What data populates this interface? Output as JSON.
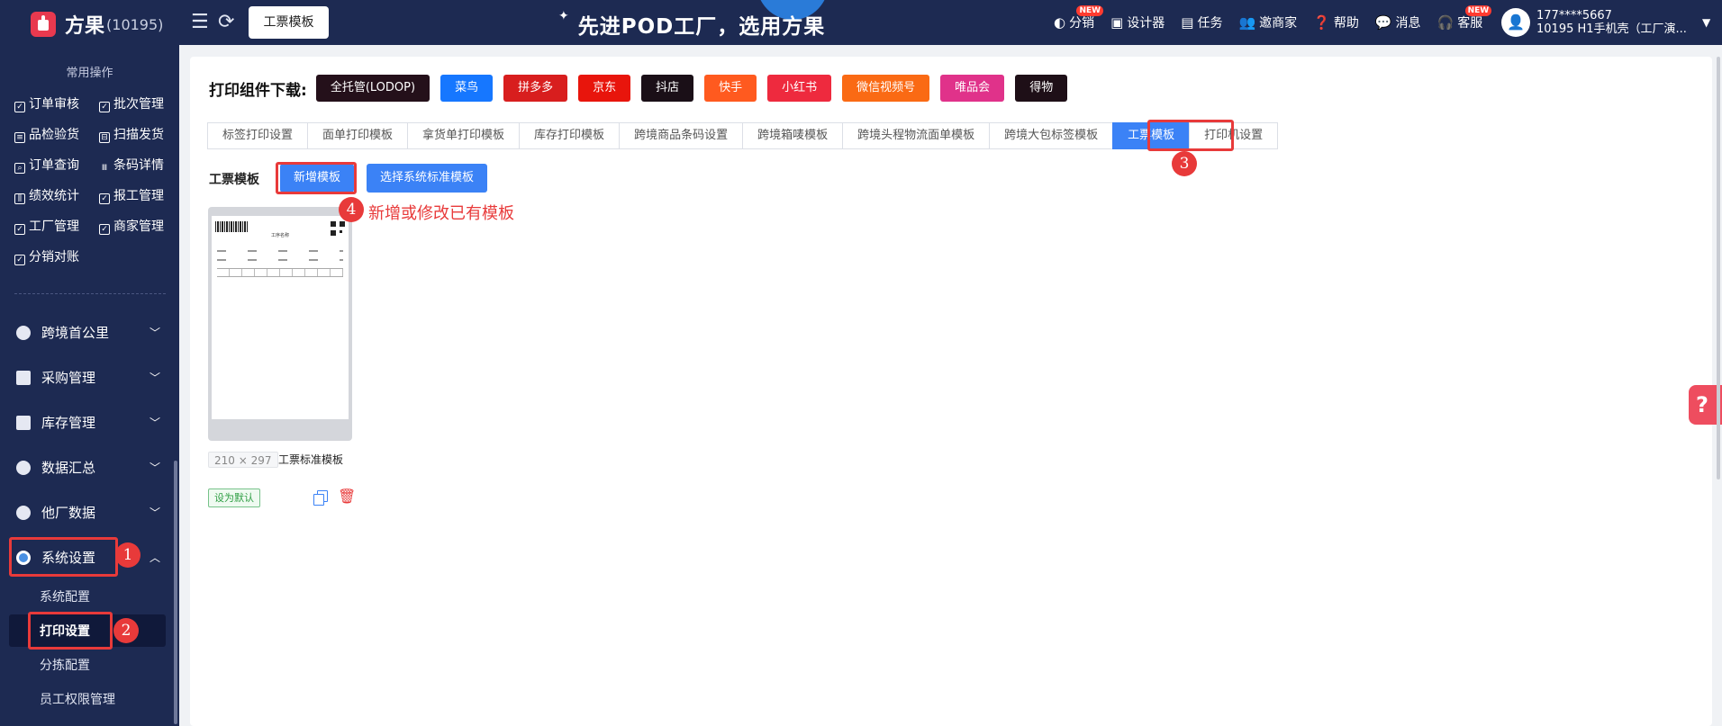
{
  "header": {
    "logo_text": "方果",
    "logo_id": "(10195)",
    "active_tab": "工票模板",
    "slogan": "先进POD工厂，选用方果",
    "nav": [
      {
        "label": "分销",
        "icon": "distribution-icon",
        "badge": "NEW"
      },
      {
        "label": "设计器",
        "icon": "image-icon",
        "badge": ""
      },
      {
        "label": "任务",
        "icon": "task-icon",
        "badge": ""
      },
      {
        "label": "邀商家",
        "icon": "users-icon",
        "badge": ""
      },
      {
        "label": "帮助",
        "icon": "help-icon",
        "badge": ""
      },
      {
        "label": "消息",
        "icon": "message-icon",
        "badge": ""
      },
      {
        "label": "客服",
        "icon": "headset-icon",
        "badge": "NEW"
      }
    ],
    "user": {
      "phone": "177****5667",
      "shop": "10195 H1手机壳（工厂演..."
    }
  },
  "sidebar": {
    "section_title": "常用操作",
    "quick_actions": [
      "订单审核",
      "批次管理",
      "品检验货",
      "扫描发货",
      "订单查询",
      "条码详情",
      "绩效统计",
      "报工管理",
      "工厂管理",
      "商家管理",
      "分销对账"
    ],
    "menus": [
      "跨境首公里",
      "采购管理",
      "库存管理",
      "数据汇总",
      "他厂数据",
      "系统设置"
    ],
    "submenus": [
      "系统配置",
      "打印设置",
      "分拣配置",
      "员工权限管理"
    ]
  },
  "download": {
    "label": "打印组件下载:",
    "buttons": [
      {
        "label": "全托管(LODOP)",
        "color": "#24101a"
      },
      {
        "label": "菜鸟",
        "color": "#1677ff"
      },
      {
        "label": "拼多多",
        "color": "#d81e1e"
      },
      {
        "label": "京东",
        "color": "#e8150c"
      },
      {
        "label": "抖店",
        "color": "#1a0f17"
      },
      {
        "label": "快手",
        "color": "#ff5a1f"
      },
      {
        "label": "小红书",
        "color": "#ee2a3e"
      },
      {
        "label": "微信视频号",
        "color": "#fa6a14"
      },
      {
        "label": "唯品会",
        "color": "#e0328a"
      },
      {
        "label": "得物",
        "color": "#1e0f17"
      }
    ]
  },
  "tabs": [
    "标签打印设置",
    "面单打印模板",
    "拿货单打印模板",
    "库存打印模板",
    "跨境商品条码设置",
    "跨境箱唛模板",
    "跨境头程物流面单模板",
    "跨境大包标签模板",
    "工票模板",
    "打印机设置"
  ],
  "content": {
    "section_label": "工票模板",
    "add_button": "新增模板",
    "select_button": "选择系统标准模板",
    "annotation": "新增或修改已有模板",
    "template": {
      "paper_title": "工序名称",
      "size": "210 × 297",
      "name": "工票标准模板",
      "default_label": "设为默认"
    }
  },
  "markers": [
    "1",
    "2",
    "3",
    "4"
  ],
  "help_glyph": "?"
}
